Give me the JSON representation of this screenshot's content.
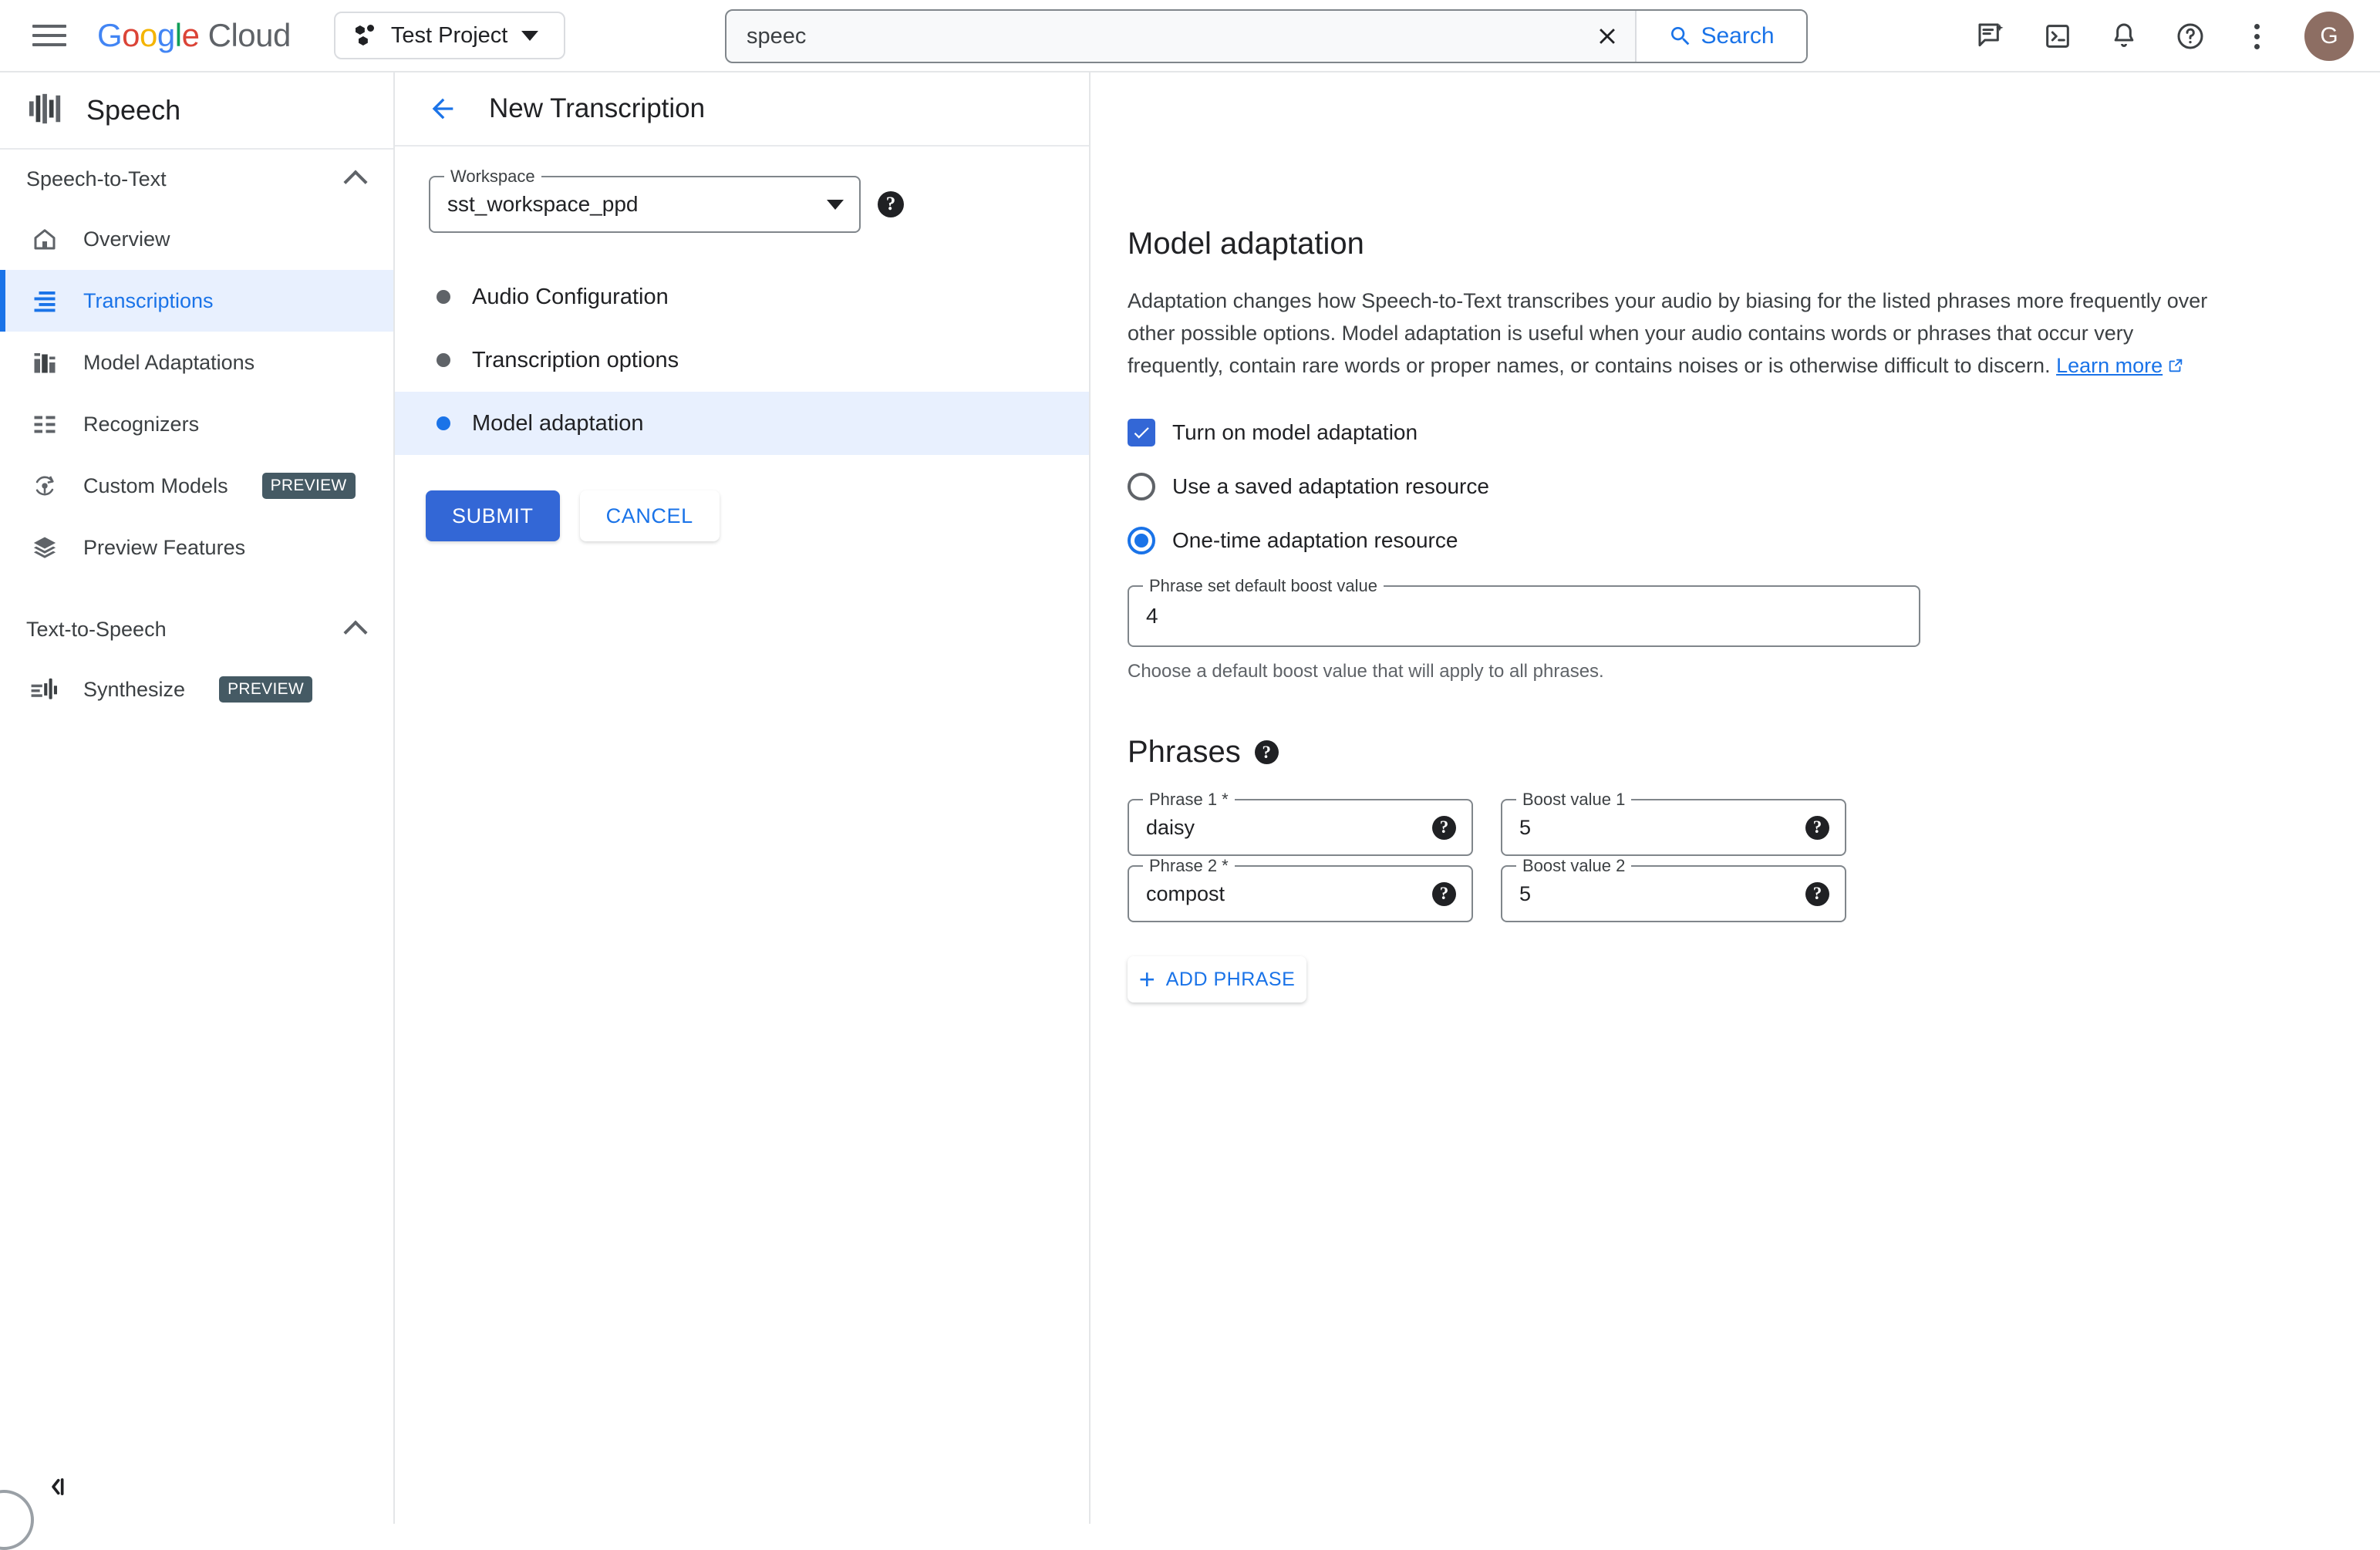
{
  "topbar": {
    "menu_icon": "hamburger-icon",
    "logo": {
      "google": "Google",
      "cloud": "Cloud"
    },
    "project": {
      "name": "Test Project",
      "icon": "project-dots-icon"
    },
    "search": {
      "value": "speec",
      "placeholder": "Search",
      "button_label": "Search",
      "clear_icon": "close-icon",
      "search_icon": "search-icon"
    },
    "icons": [
      {
        "name": "gemini-chat-icon"
      },
      {
        "name": "cloud-shell-icon"
      },
      {
        "name": "notifications-bell-icon"
      },
      {
        "name": "help-circle-icon"
      },
      {
        "name": "kebab-menu-icon"
      }
    ],
    "avatar_letter": "G",
    "avatar_color": "#8d6e63"
  },
  "sidebar": {
    "product_title": "Speech",
    "product_icon": "speech-waveform-icon",
    "sections": [
      {
        "title": "Speech-to-Text",
        "items": [
          {
            "label": "Overview",
            "icon": "home-icon",
            "active": false,
            "badge": ""
          },
          {
            "label": "Transcriptions",
            "icon": "transcriptions-list-icon",
            "active": true,
            "badge": ""
          },
          {
            "label": "Model Adaptations",
            "icon": "model-adaptations-bars-icon",
            "active": false,
            "badge": ""
          },
          {
            "label": "Recognizers",
            "icon": "recognizers-list-icon",
            "active": false,
            "badge": ""
          },
          {
            "label": "Custom Models",
            "icon": "custom-models-icon",
            "active": false,
            "badge": "PREVIEW"
          },
          {
            "label": "Preview Features",
            "icon": "layers-icon",
            "active": false,
            "badge": ""
          }
        ]
      },
      {
        "title": "Text-to-Speech",
        "items": [
          {
            "label": "Synthesize",
            "icon": "synthesize-icon",
            "active": false,
            "badge": "PREVIEW"
          }
        ]
      }
    ],
    "collapse_icon": "collapse-panel-icon"
  },
  "midpanel": {
    "back_icon": "back-arrow-icon",
    "page_title": "New Transcription",
    "workspace": {
      "label": "Workspace",
      "value": "sst_workspace_ppd",
      "help_icon": "help-icon",
      "dropdown_icon": "chevron-down-icon"
    },
    "steps": [
      {
        "label": "Audio Configuration",
        "current": false
      },
      {
        "label": "Transcription options",
        "current": false
      },
      {
        "label": "Model adaptation",
        "current": true
      }
    ],
    "submit_label": "SUBMIT",
    "cancel_label": "CANCEL"
  },
  "content": {
    "section_title": "Model adaptation",
    "description": "Adaptation changes how Speech-to-Text transcribes your audio by biasing for the listed phrases more frequently over other possible options. Model adaptation is useful when your audio contains words or phrases that occur very frequently, contain rare words or proper names, or contains noises or is otherwise difficult to discern.",
    "learn_more": "Learn more",
    "turn_on_label": "Turn on model adaptation",
    "turn_on_checked": true,
    "radio_options": [
      {
        "label": "Use a saved adaptation resource",
        "selected": false
      },
      {
        "label": "One-time adaptation resource",
        "selected": true
      }
    ],
    "boost_default": {
      "label": "Phrase set default boost value",
      "value": "4",
      "hint": "Choose a default boost value that will apply to all phrases."
    },
    "phrases_title": "Phrases",
    "phrases_help_icon": "help-icon",
    "phrase_rows": [
      {
        "phrase_label": "Phrase 1 *",
        "phrase_value": "daisy",
        "boost_label": "Boost value 1",
        "boost_value": "5"
      },
      {
        "phrase_label": "Phrase 2 *",
        "phrase_value": "compost",
        "boost_label": "Boost value 2",
        "boost_value": "5"
      }
    ],
    "add_phrase_label": "ADD PHRASE",
    "accent_color": "#1a73e8"
  }
}
